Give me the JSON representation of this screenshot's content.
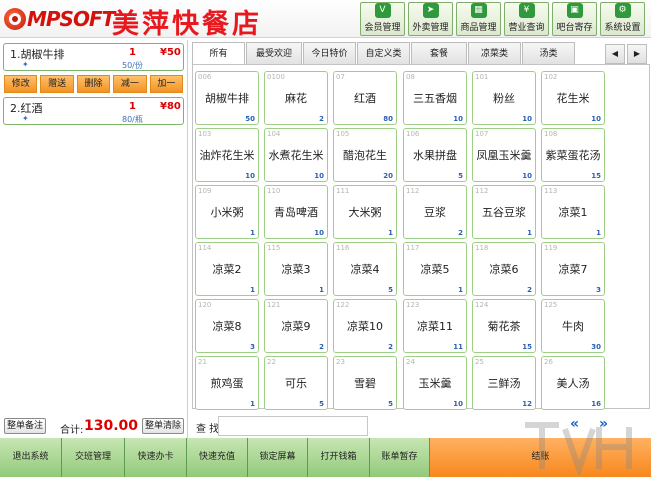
{
  "header": {
    "logo_text": "MPSOFT",
    "shop_name": "美萍快餐店",
    "buttons": [
      {
        "label": "会员管理",
        "icon": "vip"
      },
      {
        "label": "外卖管理",
        "icon": "delivery"
      },
      {
        "label": "商品管理",
        "icon": "goods"
      },
      {
        "label": "营业查询",
        "icon": "yen"
      },
      {
        "label": "吧台寄存",
        "icon": "storage"
      },
      {
        "label": "系统设置",
        "icon": "gear"
      }
    ]
  },
  "order": {
    "items": [
      {
        "name": "1.胡椒牛排",
        "qty": "1",
        "price": "¥50",
        "unit": "50/份"
      },
      {
        "name": "2.红酒",
        "qty": "1",
        "price": "¥80",
        "unit": "80/瓶"
      }
    ],
    "actions": [
      "修改",
      "赠送",
      "删除",
      "减一",
      "加一"
    ],
    "note_button": "整单备注",
    "total_label": "合计:",
    "total_value": "130.00",
    "clear_button": "整单清除"
  },
  "tabs": [
    "所有",
    "最受欢迎",
    "今日特价",
    "自定义类",
    "套餐",
    "凉菜类",
    "汤类"
  ],
  "tiles": [
    {
      "code": "006",
      "name": "胡椒牛排",
      "count": "50"
    },
    {
      "code": "0100",
      "name": "麻花",
      "count": "2"
    },
    {
      "code": "07",
      "name": "红酒",
      "count": "80"
    },
    {
      "code": "08",
      "name": "三五香烟",
      "count": "10"
    },
    {
      "code": "101",
      "name": "粉丝",
      "count": "10"
    },
    {
      "code": "102",
      "name": "花生米",
      "count": "10"
    },
    {
      "code": "103",
      "name": "油炸花生米",
      "count": "10"
    },
    {
      "code": "104",
      "name": "水煮花生米",
      "count": "10"
    },
    {
      "code": "105",
      "name": "醋泡花生",
      "count": "20"
    },
    {
      "code": "106",
      "name": "水果拼盘",
      "count": "5"
    },
    {
      "code": "107",
      "name": "凤凰玉米羹",
      "count": "10"
    },
    {
      "code": "108",
      "name": "紫菜蛋花汤",
      "count": "15"
    },
    {
      "code": "109",
      "name": "小米粥",
      "count": "1"
    },
    {
      "code": "110",
      "name": "青岛啤酒",
      "count": "10"
    },
    {
      "code": "111",
      "name": "大米粥",
      "count": "1"
    },
    {
      "code": "112",
      "name": "豆浆",
      "count": "2"
    },
    {
      "code": "112",
      "name": "五谷豆浆",
      "count": "1"
    },
    {
      "code": "113",
      "name": "凉菜1",
      "count": "1"
    },
    {
      "code": "114",
      "name": "凉菜2",
      "count": "1"
    },
    {
      "code": "115",
      "name": "凉菜3",
      "count": "1"
    },
    {
      "code": "116",
      "name": "凉菜4",
      "count": "5"
    },
    {
      "code": "117",
      "name": "凉菜5",
      "count": "1"
    },
    {
      "code": "118",
      "name": "凉菜6",
      "count": "2"
    },
    {
      "code": "119",
      "name": "凉菜7",
      "count": "3"
    },
    {
      "code": "120",
      "name": "凉菜8",
      "count": "3"
    },
    {
      "code": "121",
      "name": "凉菜9",
      "count": "2"
    },
    {
      "code": "122",
      "name": "凉菜10",
      "count": "2"
    },
    {
      "code": "123",
      "name": "凉菜11",
      "count": "11"
    },
    {
      "code": "124",
      "name": "菊花茶",
      "count": "15"
    },
    {
      "code": "125",
      "name": "牛肉",
      "count": "30"
    },
    {
      "code": "21",
      "name": "煎鸡蛋",
      "count": "1"
    },
    {
      "code": "22",
      "name": "可乐",
      "count": "5"
    },
    {
      "code": "23",
      "name": "雪碧",
      "count": "5"
    },
    {
      "code": "24",
      "name": "玉米羹",
      "count": "10"
    },
    {
      "code": "25",
      "name": "三鲜汤",
      "count": "12"
    },
    {
      "code": "26",
      "name": "美人汤",
      "count": "16"
    }
  ],
  "search": {
    "label": "查 找",
    "value": ""
  },
  "pager": {
    "prev": "«",
    "next": "»"
  },
  "footer": [
    "退出系统",
    "交班管理",
    "快速办卡",
    "快速充值",
    "锁定屏幕",
    "打开钱箱",
    "账单暂存",
    "结账"
  ],
  "colors": {
    "brand_red": "#d3120c",
    "accent_green": "#9fcf87",
    "checkout_orange": "#f7871d",
    "count_blue": "#2a5fb0"
  }
}
